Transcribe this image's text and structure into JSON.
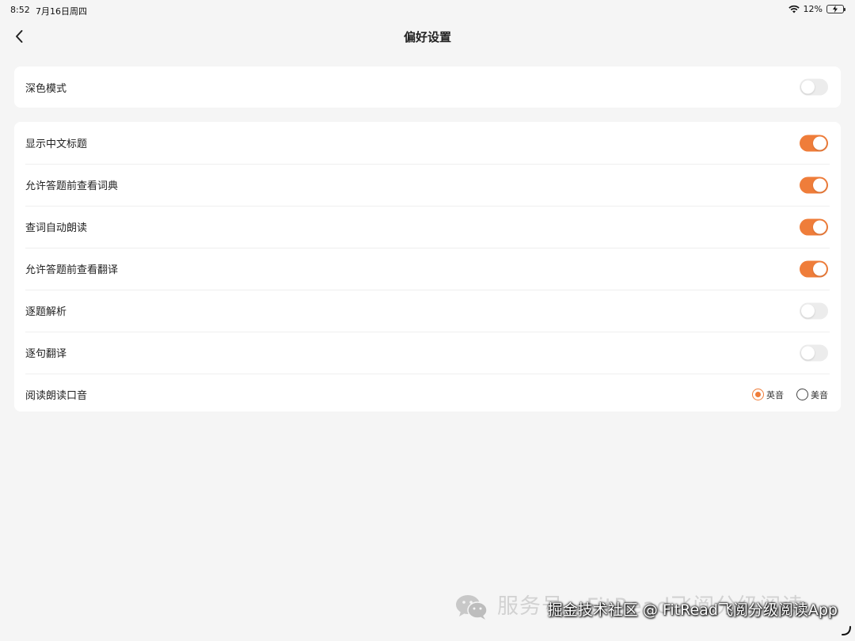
{
  "status": {
    "time": "8:52",
    "date": "7月16日周四",
    "battery": "12%"
  },
  "nav": {
    "title": "偏好设置"
  },
  "colors": {
    "accent": "#ef7d3a",
    "toggle_off": "#ececec",
    "background": "#f5f5f5"
  },
  "dark_mode": {
    "label": "深色模式",
    "on": false
  },
  "settings": [
    {
      "label": "显示中文标题",
      "on": true
    },
    {
      "label": "允许答题前查看词典",
      "on": true
    },
    {
      "label": "查词自动朗读",
      "on": true
    },
    {
      "label": "允许答题前查看翻译",
      "on": true
    },
    {
      "label": "逐题解析",
      "on": false
    },
    {
      "label": "逐句翻译",
      "on": false
    }
  ],
  "accent_setting": {
    "label": "阅读朗读口音",
    "options": [
      {
        "label": "英音",
        "selected": true
      },
      {
        "label": "美音",
        "selected": false
      }
    ]
  },
  "watermark": {
    "background_text": "服务号 · FitRead飞阅分级阅读",
    "foreground_text": "掘金技术社区 @ FitRead飞阅分级阅读App"
  }
}
